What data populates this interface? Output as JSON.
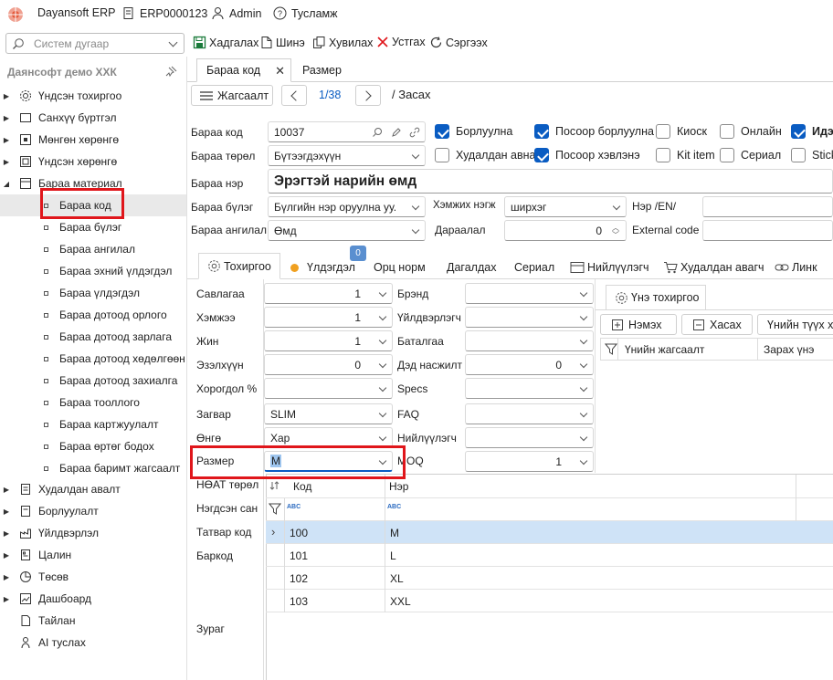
{
  "topbar": {
    "app_name": "Dayansoft ERP",
    "doc_code": "ERP0000123",
    "user": "Admin",
    "help": "Тусламж"
  },
  "search": {
    "placeholder": "Систем дугаар"
  },
  "toolbar": {
    "save": "Хадгалах",
    "new": "Шинэ",
    "copy": "Хувилах",
    "delete": "Устгах",
    "refresh": "Сэргээх"
  },
  "sidebar": {
    "company": "Даянсофт демо ХХК",
    "items": [
      {
        "label": "Үндсэн тохиргоо"
      },
      {
        "label": "Санхүү бүртгэл"
      },
      {
        "label": "Мөнгөн хөрөнгө"
      },
      {
        "label": "Үндсэн хөрөнгө"
      },
      {
        "label": "Бараа материал"
      }
    ],
    "sub_items": [
      {
        "label": "Бараа код"
      },
      {
        "label": "Бараа бүлэг"
      },
      {
        "label": "Бараа ангилал"
      },
      {
        "label": "Бараа эхний үлдэгдэл"
      },
      {
        "label": "Бараа үлдэгдэл"
      },
      {
        "label": "Бараа дотоод орлого"
      },
      {
        "label": "Бараа дотоод зарлага"
      },
      {
        "label": "Бараа дотоод хөдөлгөөн"
      },
      {
        "label": "Бараа дотоод захиалга"
      },
      {
        "label": "Бараа тооллого"
      },
      {
        "label": "Бараа картжуулалт"
      },
      {
        "label": "Бараа өртөг бодох"
      },
      {
        "label": "Бараа баримт жагсаалт"
      }
    ],
    "items2": [
      {
        "label": "Худалдан авалт"
      },
      {
        "label": "Борлуулалт"
      },
      {
        "label": "Үйлдвэрлэл"
      },
      {
        "label": "Цалин"
      },
      {
        "label": "Төсөв"
      },
      {
        "label": "Дашбоард"
      },
      {
        "label": "Тайлан"
      },
      {
        "label": "AI туслах"
      }
    ]
  },
  "doc_tabs": [
    "Бараа код",
    "Размер"
  ],
  "nav": {
    "list": "Жагсаалт",
    "position": "1/38",
    "mode": "/ Засах"
  },
  "form": {
    "code_label": "Бараа код",
    "code": "10037",
    "type_label": "Бараа төрөл",
    "type": "Бүтээгдэхүүн",
    "name_label": "Бараа нэр",
    "name": "Эрэгтэй нарийн өмд",
    "group_label": "Бараа бүлэг",
    "group": "Бүлгийн нэр оруулна уу.",
    "category_label": "Бараа ангилал",
    "category": "Өмд",
    "unit_label": "Хэмжих нэгж",
    "unit": "ширхэг",
    "seq_label": "Дараалал",
    "seq": "0",
    "name_en_label": "Нэр /EN/",
    "external_label": "External code",
    "checks": [
      {
        "label": "Борлуулна",
        "on": true
      },
      {
        "label": "Посоор борлуулна",
        "on": true
      },
      {
        "label": "Киоск",
        "on": false
      },
      {
        "label": "Онлайн",
        "on": false
      },
      {
        "label": "Идэ",
        "on": true
      },
      {
        "label": "Худалдан авна",
        "on": false
      },
      {
        "label": "Посоор хэвлэнэ",
        "on": true
      },
      {
        "label": "Kit item",
        "on": false
      },
      {
        "label": "Сериал",
        "on": false
      },
      {
        "label": "Stick",
        "on": false
      }
    ]
  },
  "sub_tabs": {
    "settings": "Тохиргоо",
    "balance": "Үлдэгдэл",
    "badge": "0",
    "inbound": "Орц норм",
    "companion": "Дагалдах",
    "serial": "Сериал",
    "supplier": "Нийлүүлэгч",
    "buyer": "Худалдан авагч",
    "link": "Линк"
  },
  "settings": {
    "left": [
      {
        "label": "Савлагаа",
        "value": "1"
      },
      {
        "label": "Хэмжээ",
        "value": "1"
      },
      {
        "label": "Жин",
        "value": "1"
      },
      {
        "label": "Эзэлхүүн",
        "value": "0"
      },
      {
        "label": "Хорогдол %",
        "value": ""
      },
      {
        "label": "Загвар",
        "value": "SLIM"
      },
      {
        "label": "Өнгө",
        "value": "Хар"
      },
      {
        "label": "Размер",
        "value": "M"
      },
      {
        "label": "НӨАТ төрөл",
        "value": ""
      },
      {
        "label": "Нэгдсэн сан",
        "value": ""
      },
      {
        "label": "Татвар код",
        "value": ""
      },
      {
        "label": "Баркод",
        "value": ""
      },
      {
        "label": "Зураг",
        "value": ""
      }
    ],
    "right": [
      {
        "label": "Брэнд",
        "value": ""
      },
      {
        "label": "Үйлдвэрлэгч",
        "value": ""
      },
      {
        "label": "Баталгаа",
        "value": ""
      },
      {
        "label": "Дэд насжилт",
        "value": "0"
      },
      {
        "label": "Specs",
        "value": ""
      },
      {
        "label": "FAQ",
        "value": ""
      },
      {
        "label": "Нийлүүлэгч",
        "value": ""
      },
      {
        "label": "MOQ",
        "value": "1"
      }
    ]
  },
  "price_panel": {
    "tab": "Үнэ тохиргоо",
    "add": "Нэмэх",
    "remove": "Хасах",
    "history": "Үнийн түүх ха",
    "col1": "Үнийн жагсаалт",
    "col2": "Зарах үнэ"
  },
  "size_grid": {
    "col_code": "Код",
    "col_name": "Нэр",
    "rows": [
      {
        "code": "100",
        "name": "M"
      },
      {
        "code": "101",
        "name": "L"
      },
      {
        "code": "102",
        "name": "XL"
      },
      {
        "code": "103",
        "name": "XXL"
      }
    ]
  },
  "colors": {
    "accent": "#0a5cc2",
    "highlight": "#e0161b",
    "selected_row": "#cfe3f7"
  }
}
